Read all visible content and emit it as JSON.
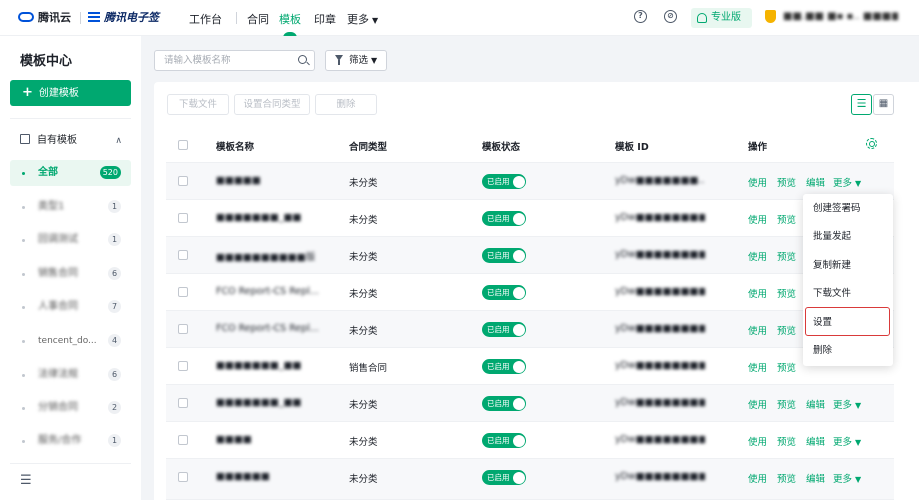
{
  "topbar": {
    "logo_cloud": "腾讯云",
    "logo_esign": "腾讯电子签",
    "nav": [
      "工作台",
      "合同",
      "模板",
      "印章",
      "更多"
    ],
    "active_nav": "模板",
    "help_icon": "question-circle-icon",
    "compass_icon": "compass-icon",
    "pro_badge": "专业版",
    "user_name": "■■.■■ ■▪ ▪.. ■■■■ ■■ ▪"
  },
  "sidebar": {
    "title": "模板中心",
    "create_button": "创建模板",
    "group_title": "自有模板",
    "items": [
      {
        "label": "全部",
        "count": "520",
        "active": true
      },
      {
        "label": "类型1",
        "count": "1"
      },
      {
        "label": "回调测试",
        "count": "1"
      },
      {
        "label": "销售合同",
        "count": "6"
      },
      {
        "label": "人事合同",
        "count": "7"
      },
      {
        "label": "tencent_do...",
        "count": "4"
      },
      {
        "label": "法律法规",
        "count": "6"
      },
      {
        "label": "分销合同",
        "count": "2"
      },
      {
        "label": "服务/合作",
        "count": "1"
      }
    ]
  },
  "search": {
    "placeholder": "请输入模板名称"
  },
  "filter": {
    "label": "筛选"
  },
  "toolbar": {
    "download": "下载文件",
    "set_type": "设置合同类型",
    "delete": "删除"
  },
  "table": {
    "headers": [
      "模板名称",
      "合同类型",
      "模板状态",
      "模板 ID",
      "操作"
    ],
    "status_label": "已启用",
    "ops": {
      "use": "使用",
      "preview": "预览",
      "edit": "编辑",
      "more": "更多"
    },
    "rows": [
      {
        "name": "■■■■■",
        "type": "未分类",
        "id": "yDw■■■■■■■..."
      },
      {
        "name": "■■■■■■■_■■",
        "type": "未分类",
        "id": "yDw■■■■■■■■..."
      },
      {
        "name": "■■■■■■■■■■版",
        "type": "未分类",
        "id": "yDw■■■■■■■■..."
      },
      {
        "name": "FCO Report-CS Repl...",
        "type": "未分类",
        "id": "yDw■■■■■■■■..."
      },
      {
        "name": "FCO Report-CS Repl...",
        "type": "未分类",
        "id": "yDw■■■■■■■■..."
      },
      {
        "name": "■■■■■■■_■■",
        "type": "销售合同",
        "id": "yDw■■■■■■■■..."
      },
      {
        "name": "■■■■■■■_■■",
        "type": "未分类",
        "id": "yDw■■■■■■■■..."
      },
      {
        "name": "■■■■",
        "type": "未分类",
        "id": "yDw■■■■■■■■..."
      },
      {
        "name": "■■■■■■",
        "type": "未分类",
        "id": "yDw■■■■■■■■..."
      }
    ]
  },
  "more_menu": {
    "items": [
      "创建签署码",
      "批量发起",
      "复制新建",
      "下载文件",
      "设置",
      "删除"
    ],
    "highlighted": "设置"
  },
  "colors": {
    "accent": "#00a870",
    "highlight_border": "#d93a3a"
  }
}
